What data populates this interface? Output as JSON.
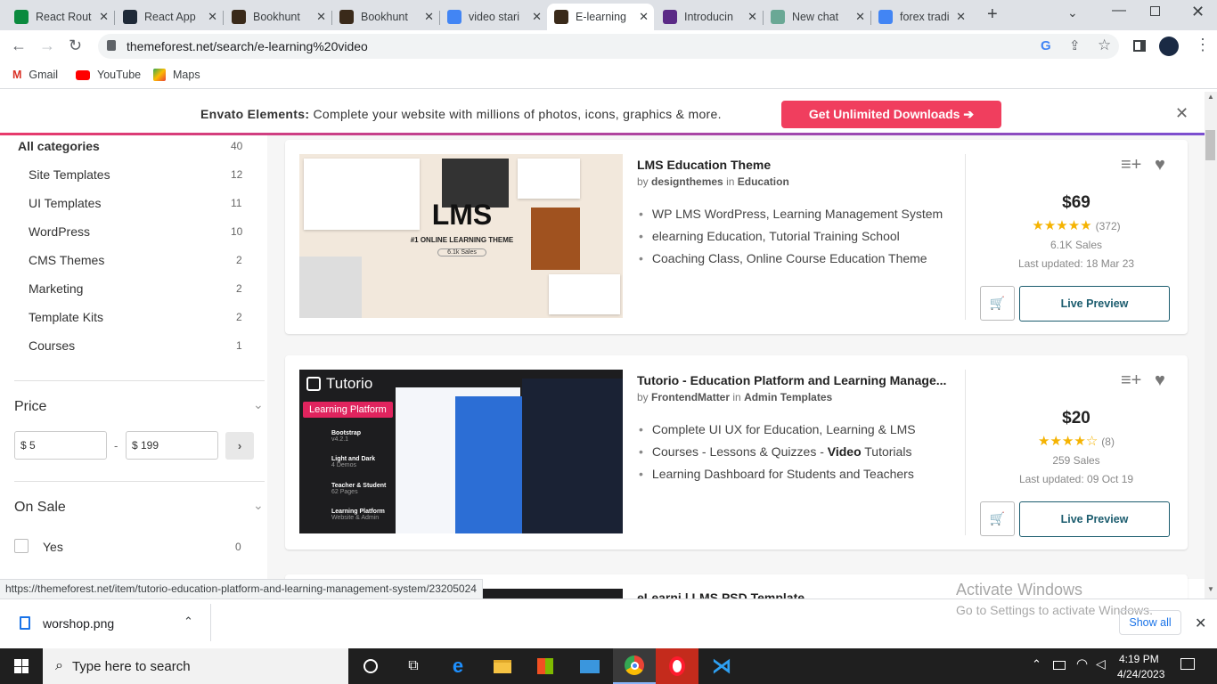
{
  "browser": {
    "tabs": [
      {
        "label": "React Rout",
        "icon": "w-icon",
        "color": "#0b8a3e"
      },
      {
        "label": "React App",
        "icon": "react-icon",
        "color": "#1f2a38"
      },
      {
        "label": "Bookhunt",
        "icon": "book-icon",
        "color": "#3a2a1a"
      },
      {
        "label": "Bookhunt",
        "icon": "book-icon",
        "color": "#3a2a1a"
      },
      {
        "label": "video stari",
        "icon": "google-icon",
        "color": "#4285f4"
      },
      {
        "label": "E-learning",
        "icon": "book-icon",
        "color": "#3a2a1a"
      },
      {
        "label": "Introducin",
        "icon": "purple-swirl-icon",
        "color": "#5b2a86"
      },
      {
        "label": "New chat",
        "icon": "chatgpt-icon",
        "color": "#6aa895"
      },
      {
        "label": "forex tradi",
        "icon": "google-icon",
        "color": "#4285f4"
      }
    ],
    "url": "themeforest.net/search/e-learning%20video",
    "bookmarks": [
      {
        "label": "Gmail",
        "icon": "gmail-icon"
      },
      {
        "label": "YouTube",
        "icon": "youtube-icon"
      },
      {
        "label": "Maps",
        "icon": "maps-icon"
      }
    ]
  },
  "banner": {
    "brand": "Envato Elements:",
    "text": "Complete your website with millions of photos, icons, graphics & more.",
    "cta": "Get Unlimited Downloads ➔"
  },
  "sidebar": {
    "all_categories": {
      "label": "All categories",
      "count": "40"
    },
    "categories": [
      {
        "label": "Site Templates",
        "count": "12"
      },
      {
        "label": "UI Templates",
        "count": "11"
      },
      {
        "label": "WordPress",
        "count": "10"
      },
      {
        "label": "CMS Themes",
        "count": "2"
      },
      {
        "label": "Marketing",
        "count": "2"
      },
      {
        "label": "Template Kits",
        "count": "2"
      },
      {
        "label": "Courses",
        "count": "1"
      }
    ],
    "price": {
      "title": "Price",
      "min": "$ 5",
      "max": "$ 199",
      "dash": "-"
    },
    "on_sale": {
      "title": "On Sale",
      "option": "Yes",
      "count": "0"
    }
  },
  "items": [
    {
      "title": "LMS Education Theme",
      "by": "by",
      "author": "designthemes",
      "in": "in",
      "category": "Education",
      "bullets": [
        "WP LMS WordPress, Learning Management System",
        "elearning Education, Tutorial Training School",
        "Coaching Class, Online Course Education Theme"
      ],
      "price": "$69",
      "stars": "★★★★★",
      "rating_count": "(372)",
      "sales": "6.1K Sales",
      "updated": "Last updated: 18 Mar 23",
      "live_preview": "Live Preview",
      "thumb_title": "LMS",
      "thumb_sub": "#1 ONLINE LEARNING THEME",
      "thumb_badge": "6.1k Sales"
    },
    {
      "title": "Tutorio - Education Platform and Learning Manage...",
      "by": "by",
      "author": "FrontendMatter",
      "in": "in",
      "category": "Admin Templates",
      "bullets": [
        "Complete UI UX for Education, Learning & LMS",
        "Courses - Lessons & Quizzes - ",
        "Learning Dashboard for Students and Teachers"
      ],
      "bullet2_bold": "Video",
      "bullet2_tail": " Tutorials",
      "price": "$20",
      "stars": "★★★★☆",
      "rating_count": "(8)",
      "sales": "259 Sales",
      "updated": "Last updated: 09 Oct 19",
      "live_preview": "Live Preview",
      "thumb_title": "Tutorio",
      "thumb_badge": "Learning Platform",
      "thumb_features": [
        {
          "t": "Bootstrap",
          "s": "v4.2.1"
        },
        {
          "t": "Light and Dark",
          "s": "4 Demos"
        },
        {
          "t": "Teacher & Student",
          "s": "62 Pages"
        },
        {
          "t": "Learning Platform",
          "s": "Website & Admin"
        }
      ]
    }
  ],
  "third_item_title": "eLearni | LMS PSD Template",
  "status_url": "https://themeforest.net/item/tutorio-education-platform-and-learning-management-system/23205024",
  "activate": {
    "title": "Activate Windows",
    "sub": "Go to Settings to activate Windows."
  },
  "download": {
    "file": "worshop.png",
    "show_all": "Show all"
  },
  "taskbar": {
    "search": "Type here to search",
    "time": "4:19 PM",
    "date": "4/24/2023"
  }
}
